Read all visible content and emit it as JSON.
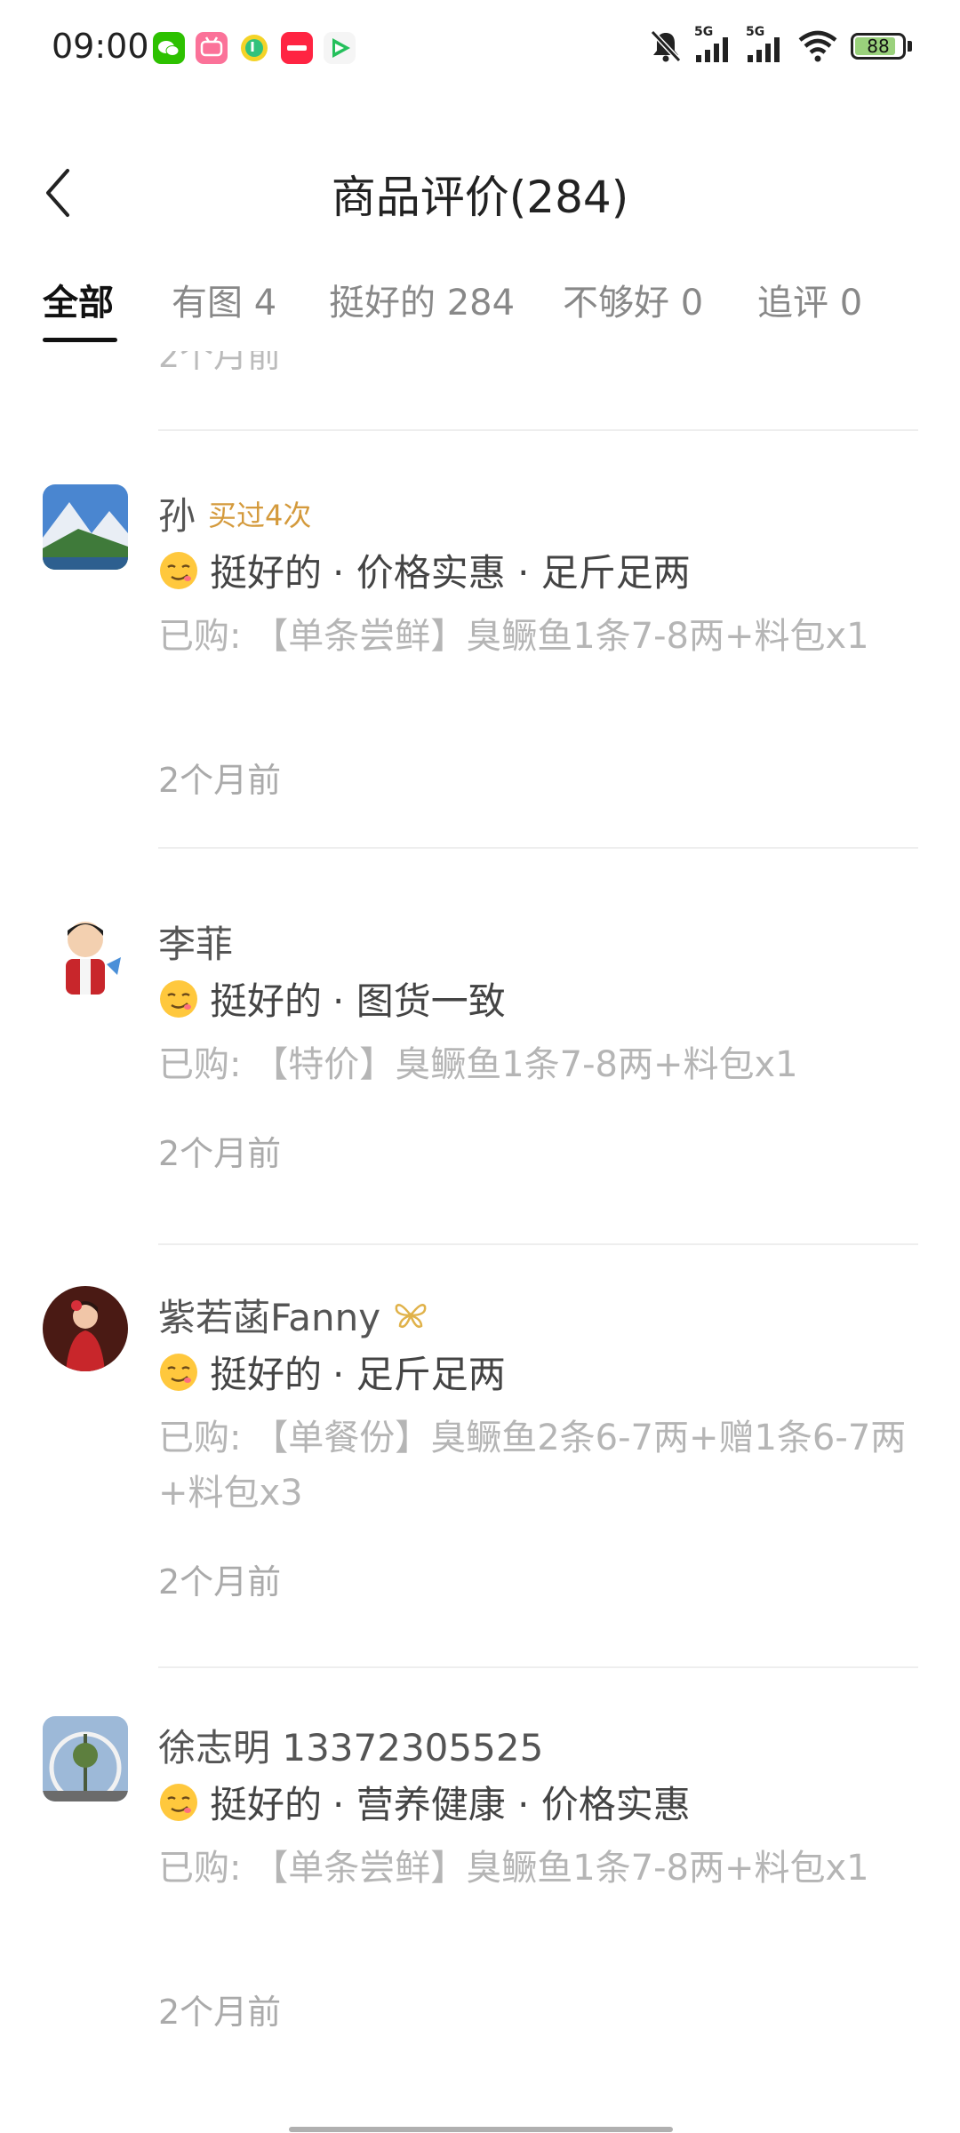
{
  "status": {
    "time": "09:00",
    "battery": "88",
    "battery_level": 0.88,
    "net1": "5G",
    "net2": "5G",
    "icons": [
      "wechat-icon",
      "bilibili-icon",
      "qq-music-icon",
      "xiaohongshu-icon",
      "tencent-video-icon",
      "mute-bell-icon",
      "signal-icon",
      "wifi-icon",
      "battery-icon"
    ]
  },
  "header": {
    "title": "商品评价(284)",
    "back_icon": "chevron-left-icon"
  },
  "tabs": [
    {
      "label": "全部"
    },
    {
      "label": "有图 4"
    },
    {
      "label": "挺好的 284"
    },
    {
      "label": "不够好 0"
    },
    {
      "label": "追评 0"
    }
  ],
  "clipped_time": "2个月前",
  "reviews": [
    {
      "name": "孙",
      "badge": "买过4次",
      "rating": "挺好的",
      "tags": "· 价格实惠 · 足斤足两",
      "purchase": "已购: 【单条尝鲜】臭鳜鱼1条7-8两+料包x1",
      "time": "2个月前"
    },
    {
      "name": "李菲",
      "rating": "挺好的",
      "tags": "· 图货一致",
      "purchase": "已购: 【特价】臭鳜鱼1条7-8两+料包x1",
      "time": "2个月前"
    },
    {
      "name": "紫若菡Fanny",
      "rating": "挺好的",
      "tags": "· 足斤足两",
      "purchase": "已购: 【单餐份】臭鳜鱼2条6-7两+赠1条6-7两+料包x3",
      "time": "2个月前"
    },
    {
      "name": "徐志明 13372305525",
      "rating": "挺好的",
      "tags": "· 营养健康 · 价格实惠",
      "purchase": "已购: 【单条尝鲜】臭鳜鱼1条7-8两+料包x1",
      "time": "2个月前"
    }
  ],
  "colors": {
    "accent_badge": "#d49a3c",
    "muted_text": "#b5b5b5"
  }
}
